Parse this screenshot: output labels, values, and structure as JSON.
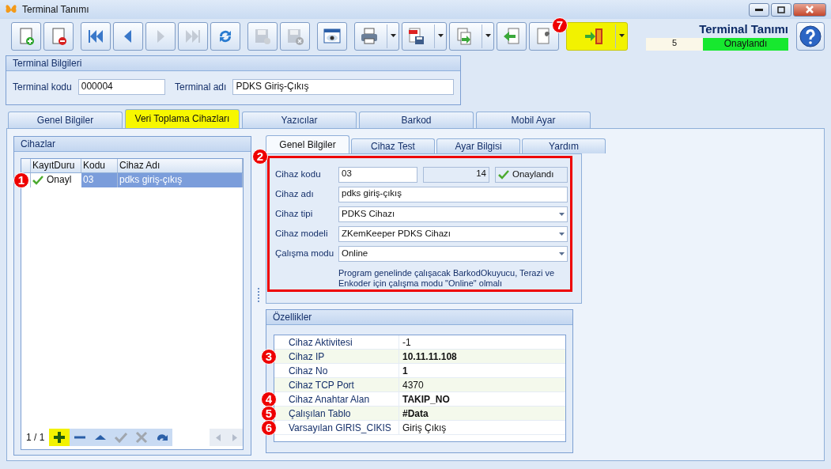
{
  "window": {
    "title": "Terminal Tanımı"
  },
  "toolbar": [
    {
      "kind": "new",
      "disabled": false,
      "dropdown": false,
      "highlighted": false
    },
    {
      "kind": "delete",
      "disabled": false,
      "dropdown": false,
      "highlighted": false
    },
    {
      "kind": "first",
      "disabled": false,
      "dropdown": false,
      "highlighted": false
    },
    {
      "kind": "prev",
      "disabled": false,
      "dropdown": false,
      "highlighted": false
    },
    {
      "kind": "next",
      "disabled": true,
      "dropdown": false,
      "highlighted": false
    },
    {
      "kind": "last",
      "disabled": true,
      "dropdown": false,
      "highlighted": false
    },
    {
      "kind": "refresh",
      "disabled": false,
      "dropdown": false,
      "highlighted": false
    },
    {
      "kind": "save",
      "disabled": true,
      "dropdown": false,
      "highlighted": false
    },
    {
      "kind": "cancel",
      "disabled": true,
      "dropdown": false,
      "highlighted": false
    },
    {
      "kind": "preview",
      "disabled": false,
      "dropdown": false,
      "highlighted": false
    },
    {
      "kind": "print",
      "disabled": false,
      "dropdown": true,
      "highlighted": false
    },
    {
      "kind": "pdf",
      "disabled": false,
      "dropdown": true,
      "highlighted": false
    },
    {
      "kind": "export",
      "disabled": false,
      "dropdown": true,
      "highlighted": false
    },
    {
      "kind": "import",
      "disabled": false,
      "dropdown": false,
      "highlighted": false
    },
    {
      "kind": "tools",
      "disabled": false,
      "dropdown": false,
      "highlighted": false
    },
    {
      "kind": "exit",
      "disabled": false,
      "dropdown": true,
      "highlighted": true,
      "callout": "7"
    }
  ],
  "header": {
    "title": "Terminal Tanımı",
    "record": "5",
    "status": "Onaylandı"
  },
  "terminal_info": {
    "title": "Terminal Bilgileri",
    "code_label": "Terminal kodu",
    "code": "000004",
    "name_label": "Terminal adı",
    "name": "PDKS Giriş-Çıkış"
  },
  "tabs": [
    {
      "label": "Genel Bilgiler",
      "selected": false
    },
    {
      "label": "Veri Toplama Cihazları",
      "selected": true
    },
    {
      "label": "Yazıcılar",
      "selected": false
    },
    {
      "label": "Barkod",
      "selected": false
    },
    {
      "label": "Mobil Ayar",
      "selected": false
    }
  ],
  "devices": {
    "title": "Cihazlar",
    "columns": [
      "KayıtDuru",
      "Kodu",
      "Cihaz Adı"
    ],
    "rows": [
      {
        "status": "Onayl",
        "approved": true,
        "code": "03",
        "name": "pdks giriş-çıkış",
        "selected": true,
        "callout": "1"
      }
    ],
    "navigator": {
      "position": "1 / 1",
      "buttons": [
        {
          "kind": "add",
          "disabled": false,
          "highlighted": true
        },
        {
          "kind": "remove",
          "disabled": false,
          "highlighted": false
        },
        {
          "kind": "up",
          "disabled": false,
          "highlighted": false
        },
        {
          "kind": "check",
          "disabled": true,
          "highlighted": false
        },
        {
          "kind": "cancel",
          "disabled": true,
          "highlighted": false
        },
        {
          "kind": "redo",
          "disabled": false,
          "highlighted": false
        }
      ]
    }
  },
  "subtabs": [
    {
      "label": "Genel Bilgiler",
      "selected": true
    },
    {
      "label": "Cihaz Test",
      "selected": false
    },
    {
      "label": "Ayar Bilgisi",
      "selected": false
    },
    {
      "label": "Yardım",
      "selected": false
    }
  ],
  "device_form": {
    "callout": "2",
    "fields": [
      {
        "label": "Cihaz kodu",
        "value": "03",
        "kind": "code",
        "count": "14",
        "status": "Onaylandı"
      },
      {
        "label": "Cihaz adı",
        "value": "pdks giriş-çıkış",
        "kind": "text"
      },
      {
        "label": "Cihaz tipi",
        "value": "PDKS Cihazı",
        "kind": "combo"
      },
      {
        "label": "Cihaz modeli",
        "value": "ZKemKeeper PDKS Cihazı",
        "kind": "combo"
      },
      {
        "label": "Çalışma modu",
        "value": "Online",
        "kind": "combo"
      }
    ],
    "note": "Program genelinde çalışacak BarkodOkuyucu, Terazi ve Enkoder için çalışma modu \"Online\" olmalı"
  },
  "properties": {
    "title": "Özellikler",
    "rows": [
      {
        "name": "Cihaz Aktivitesi",
        "value": "-1",
        "bold": false
      },
      {
        "name": "Cihaz IP",
        "value": "10.11.11.108",
        "bold": true,
        "callout": "3"
      },
      {
        "name": "Cihaz No",
        "value": "1",
        "bold": true
      },
      {
        "name": "Cihaz TCP Port",
        "value": "4370",
        "bold": false
      },
      {
        "name": "Cihaz Anahtar Alan",
        "value": "TAKIP_NO",
        "bold": true,
        "callout": "4"
      },
      {
        "name": "Çalışılan Tablo",
        "value": "#Data",
        "bold": true,
        "callout": "5"
      },
      {
        "name": "Varsayılan GIRIS_CIKIS",
        "value": "Giriş Çıkış",
        "bold": false,
        "callout": "6"
      }
    ]
  }
}
